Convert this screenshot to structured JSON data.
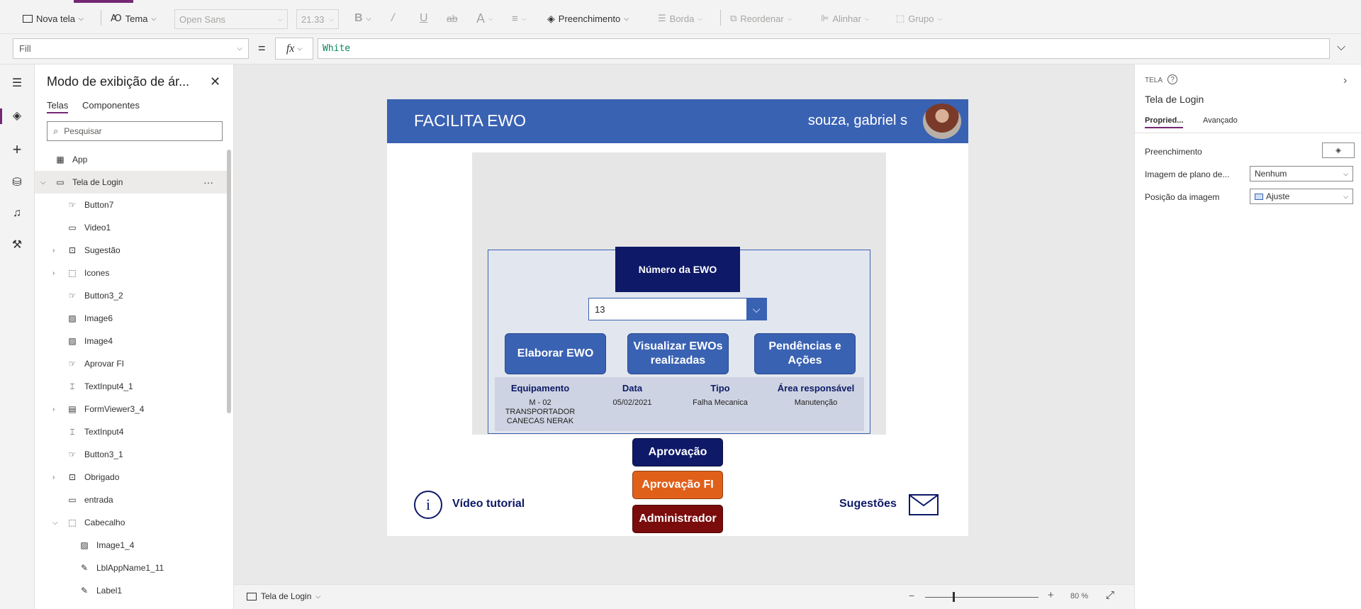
{
  "toolbar": {
    "new_screen": "Nova tela",
    "theme": "Tema",
    "font": "Open Sans",
    "font_size": "21.33",
    "fill": "Preenchimento",
    "border": "Borda",
    "reorder": "Reordenar",
    "align": "Alinhar",
    "group": "Grupo"
  },
  "formula_bar": {
    "property": "Fill",
    "equals": "=",
    "fx": "fx",
    "formula": "White"
  },
  "tree": {
    "title": "Modo de exibição de ár...",
    "tabs": [
      "Telas",
      "Componentes"
    ],
    "search_placeholder": "Pesquisar",
    "items": [
      {
        "label": "App",
        "level": 0,
        "expand": "",
        "icon": "app-icon"
      },
      {
        "label": "Tela de Login",
        "level": 0,
        "expand": "open",
        "icon": "screen-icon",
        "selected": true
      },
      {
        "label": "Button7",
        "level": 1,
        "expand": "",
        "icon": "button-icon"
      },
      {
        "label": "Video1",
        "level": 1,
        "expand": "",
        "icon": "video-icon"
      },
      {
        "label": "Sugestão",
        "level": 1,
        "expand": "closed",
        "icon": "component-icon"
      },
      {
        "label": "Icones",
        "level": 1,
        "expand": "closed",
        "icon": "group-icon"
      },
      {
        "label": "Button3_2",
        "level": 1,
        "expand": "",
        "icon": "button-icon"
      },
      {
        "label": "Image6",
        "level": 1,
        "expand": "",
        "icon": "image-icon"
      },
      {
        "label": "Image4",
        "level": 1,
        "expand": "",
        "icon": "image-icon"
      },
      {
        "label": "Aprovar FI",
        "level": 1,
        "expand": "",
        "icon": "button-icon"
      },
      {
        "label": "TextInput4_1",
        "level": 1,
        "expand": "",
        "icon": "textinput-icon"
      },
      {
        "label": "FormViewer3_4",
        "level": 1,
        "expand": "closed",
        "icon": "form-icon"
      },
      {
        "label": "TextInput4",
        "level": 1,
        "expand": "",
        "icon": "textinput-icon"
      },
      {
        "label": "Button3_1",
        "level": 1,
        "expand": "",
        "icon": "button-icon"
      },
      {
        "label": "Obrigado",
        "level": 1,
        "expand": "closed",
        "icon": "component-icon"
      },
      {
        "label": "entrada",
        "level": 1,
        "expand": "",
        "icon": "rectangle-icon"
      },
      {
        "label": "Cabecalho",
        "level": 1,
        "expand": "open",
        "icon": "group-icon"
      },
      {
        "label": "Image1_4",
        "level": 2,
        "expand": "",
        "icon": "image-icon"
      },
      {
        "label": "LblAppName1_11",
        "level": 2,
        "expand": "",
        "icon": "label-icon"
      },
      {
        "label": "Label1",
        "level": 2,
        "expand": "",
        "icon": "label-icon"
      }
    ]
  },
  "app": {
    "title": "FACILITA EWO",
    "user": "souza, gabriel s",
    "ewo_header": "Número da EWO",
    "ewo_value": "13",
    "buttons": [
      "Elaborar EWO",
      "Visualizar EWOs realizadas",
      "Pendências e Ações"
    ],
    "table": {
      "headers": [
        "Equipamento",
        "Data",
        "Tipo",
        "Área responsável"
      ],
      "values": [
        "M - 02 TRANSPORTADOR CANECAS NERAK",
        "05/02/2021",
        "Falha Mecanica",
        "Manutenção"
      ]
    },
    "actions": [
      {
        "label": "Aprovação",
        "color": "#0e1967"
      },
      {
        "label": "Aprovação FI",
        "color": "#e0601a"
      },
      {
        "label": "Administrador",
        "color": "#7a0c0c"
      }
    ],
    "tutorial": "Vídeo tutorial",
    "suggestions": "Sugestões"
  },
  "status_bar": {
    "screen": "Tela de Login",
    "zoom": "80",
    "zoom_unit": "%"
  },
  "right_panel": {
    "section": "TELA",
    "screen_name": "Tela de Login",
    "tabs": [
      "Propried...",
      "Avançado"
    ],
    "fill_label": "Preenchimento",
    "bg_image_label": "Imagem de plano de...",
    "bg_image_value": "Nenhum",
    "img_pos_label": "Posição da imagem",
    "img_pos_value": "Ajuste"
  },
  "colors": {
    "brand": "#742774",
    "header_blue": "#3a62b3",
    "navy": "#0e1967"
  }
}
